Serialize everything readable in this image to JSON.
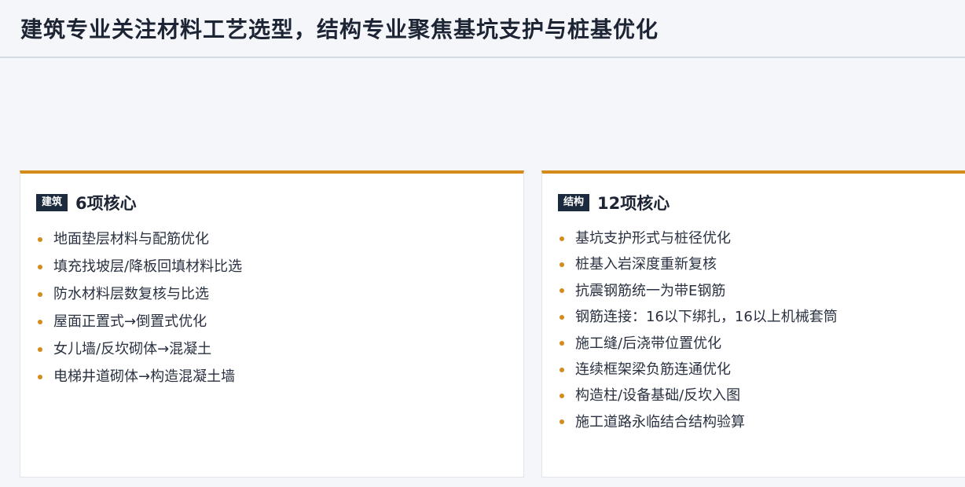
{
  "header": {
    "title": "建筑专业关注材料工艺选型，结构专业聚焦基坑支护与桩基优化"
  },
  "cards": [
    {
      "tag": "建筑",
      "title": "6项核心",
      "items": [
        "地面垫层材料与配筋优化",
        "填充找坡层/降板回填材料比选",
        "防水材料层数复核与比选",
        "屋面正置式→倒置式优化",
        "女儿墙/反坎砌体→混凝土",
        "电梯井道砌体→构造混凝土墙"
      ]
    },
    {
      "tag": "结构",
      "title": "12项核心",
      "items": [
        "基坑支护形式与桩径优化",
        "桩基入岩深度重新复核",
        "抗震钢筋统一为带E钢筋",
        "钢筋连接：16以下绑扎，16以上机械套筒",
        "施工缝/后浇带位置优化",
        "连续框架梁负筋连通优化",
        "构造柱/设备基础/反坎入图",
        "施工道路永临结合结构验算"
      ]
    }
  ],
  "colors": {
    "accent": "#d68a1a",
    "tag_bg": "#1c2a3e",
    "background": "#f4f6fa"
  }
}
